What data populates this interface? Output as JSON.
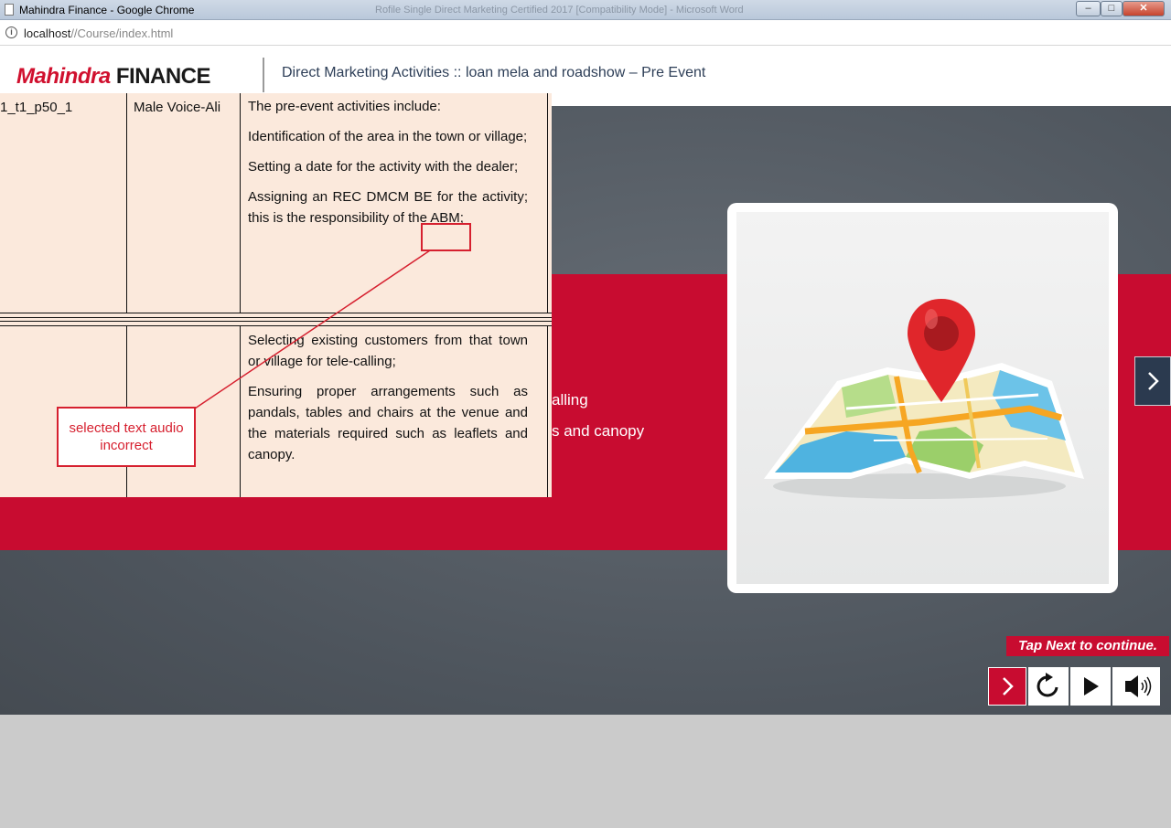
{
  "browser": {
    "window_title": "Mahindra Finance - Google Chrome",
    "background_window_title": "Rofile Single Direct Marketing Certified 2017 [Compatibility Mode] - Microsoft Word",
    "url_host": "localhost",
    "url_path": "//Course/index.html",
    "minimize_label": "–",
    "maximize_label": "□",
    "close_label": "✕"
  },
  "header": {
    "logo_mahindra": "Mahindra",
    "logo_finance": "FINANCE",
    "course_title": "Direct Marketing Activities :: loan mela and roadshow – Pre Event"
  },
  "slide": {
    "bg_text_1": "alling",
    "bg_text_2": "s and canopy",
    "tap_next": "Tap Next to continue."
  },
  "document": {
    "row1_id": "1_t1_p50_1",
    "row1_voice": "Male Voice-Ali",
    "row1_paragraphs": [
      "The pre-event activities include:",
      "Identification of the area in the town or village;",
      "Setting a date for the activity with the dealer;",
      "Assigning an REC DMCM BE for the activity; this is the responsibility of the ABM;"
    ],
    "row2_paragraphs": [
      "Selecting existing customers from that town or village for tele-calling;",
      "Ensuring proper arrangements such as pandals, tables and chairs at the venue and the materials required such as leaflets and canopy."
    ]
  },
  "annotation": {
    "callout_text": "selected text audio incorrect"
  },
  "colors": {
    "brand_red": "#c80c30",
    "annotation_red": "#d6202f",
    "nav_dark": "#2b3a4f"
  },
  "icons": [
    "info-icon",
    "document-icon",
    "map-pin-icon",
    "map-icon",
    "chevron-right-icon",
    "replay-icon",
    "play-icon",
    "volume-icon"
  ]
}
